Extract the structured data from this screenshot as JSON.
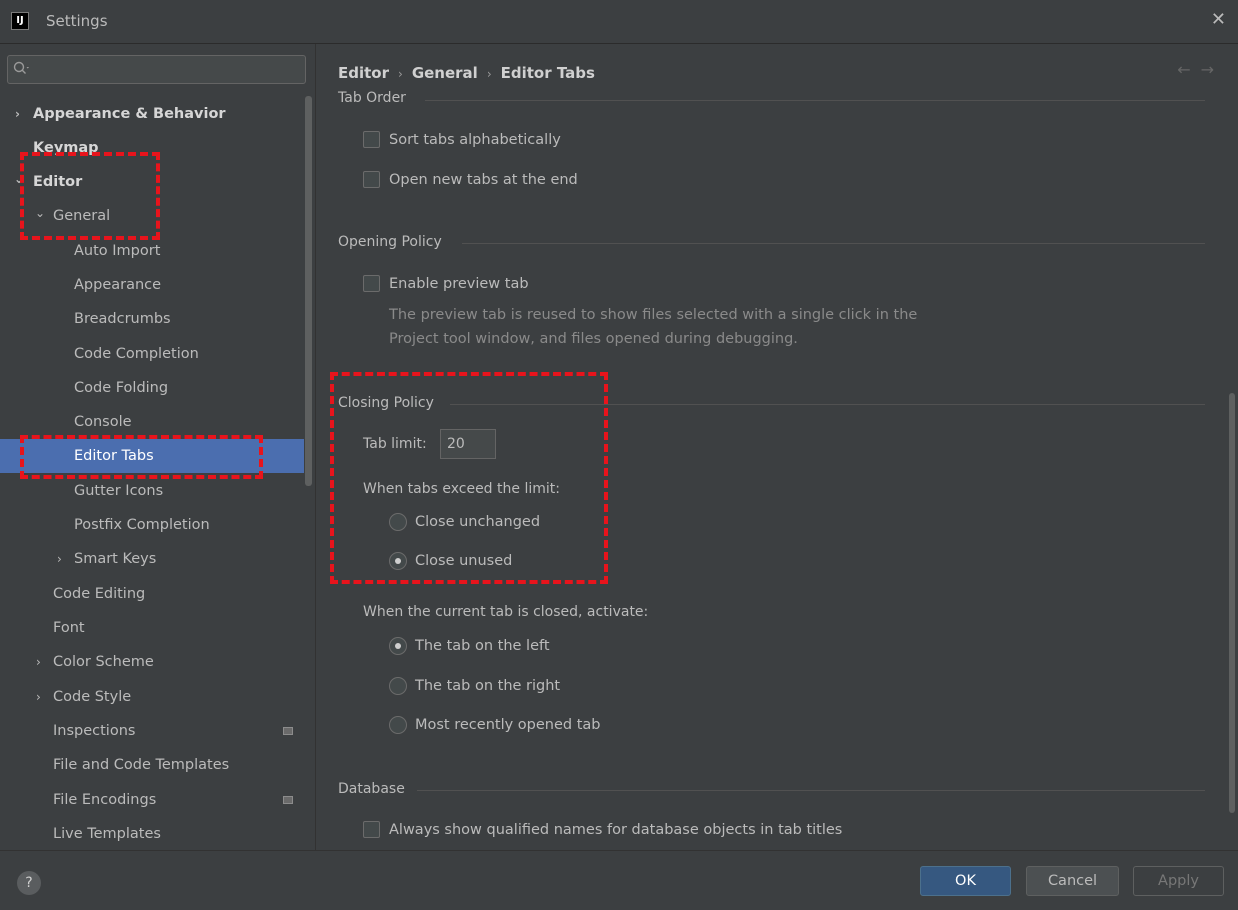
{
  "window": {
    "title": "Settings",
    "logo_text": "IJ",
    "close_glyph": "✕"
  },
  "sidebar": {
    "search_placeholder": "",
    "items": [
      {
        "label": "Appearance & Behavior",
        "chevron": "›"
      },
      {
        "label": "Keymap"
      },
      {
        "label": "Editor",
        "chevron": "⌄"
      },
      {
        "label": "General",
        "chevron": "⌄"
      },
      {
        "label": "Auto Import"
      },
      {
        "label": "Appearance"
      },
      {
        "label": "Breadcrumbs"
      },
      {
        "label": "Code Completion"
      },
      {
        "label": "Code Folding"
      },
      {
        "label": "Console"
      },
      {
        "label": "Editor Tabs",
        "selected": true
      },
      {
        "label": "Gutter Icons"
      },
      {
        "label": "Postfix Completion"
      },
      {
        "label": "Smart Keys",
        "chevron": "›"
      },
      {
        "label": "Code Editing"
      },
      {
        "label": "Font"
      },
      {
        "label": "Color Scheme",
        "chevron": "›"
      },
      {
        "label": "Code Style",
        "chevron": "›"
      },
      {
        "label": "Inspections",
        "badge": true
      },
      {
        "label": "File and Code Templates"
      },
      {
        "label": "File Encodings",
        "badge": true
      },
      {
        "label": "Live Templates"
      }
    ]
  },
  "content": {
    "breadcrumb": [
      "Editor",
      "General",
      "Editor Tabs"
    ],
    "breadcrumb_sep": "›",
    "nav_arrows": "←→",
    "tab_order": {
      "title": "Tab Order",
      "sort_alphabetically": "Sort tabs alphabetically",
      "open_at_end": "Open new tabs at the end"
    },
    "opening_policy": {
      "title": "Opening Policy",
      "enable_preview": "Enable preview tab",
      "help_line1": "The preview tab is reused to show files selected with a single click in the",
      "help_line2": "Project tool window, and files opened during debugging."
    },
    "closing_policy": {
      "title": "Closing Policy",
      "tab_limit_label": "Tab limit:",
      "tab_limit_value": "20",
      "exceed_label": "When tabs exceed the limit:",
      "close_unchanged": "Close unchanged",
      "close_unused": "Close unused",
      "activate_label": "When the current tab is closed, activate:",
      "tab_on_left": "The tab on the left",
      "tab_on_right": "The tab on the right",
      "most_recent": "Most recently opened tab"
    },
    "database": {
      "title": "Database",
      "qualified_names": "Always show qualified names for database objects in tab titles"
    }
  },
  "footer": {
    "help": "?",
    "ok": "OK",
    "cancel": "Cancel",
    "apply": "Apply"
  },
  "colors": {
    "background": "#3c3f41",
    "selection": "#4b6eaf",
    "annotation": "#e8141c",
    "ok_button": "#365880"
  }
}
